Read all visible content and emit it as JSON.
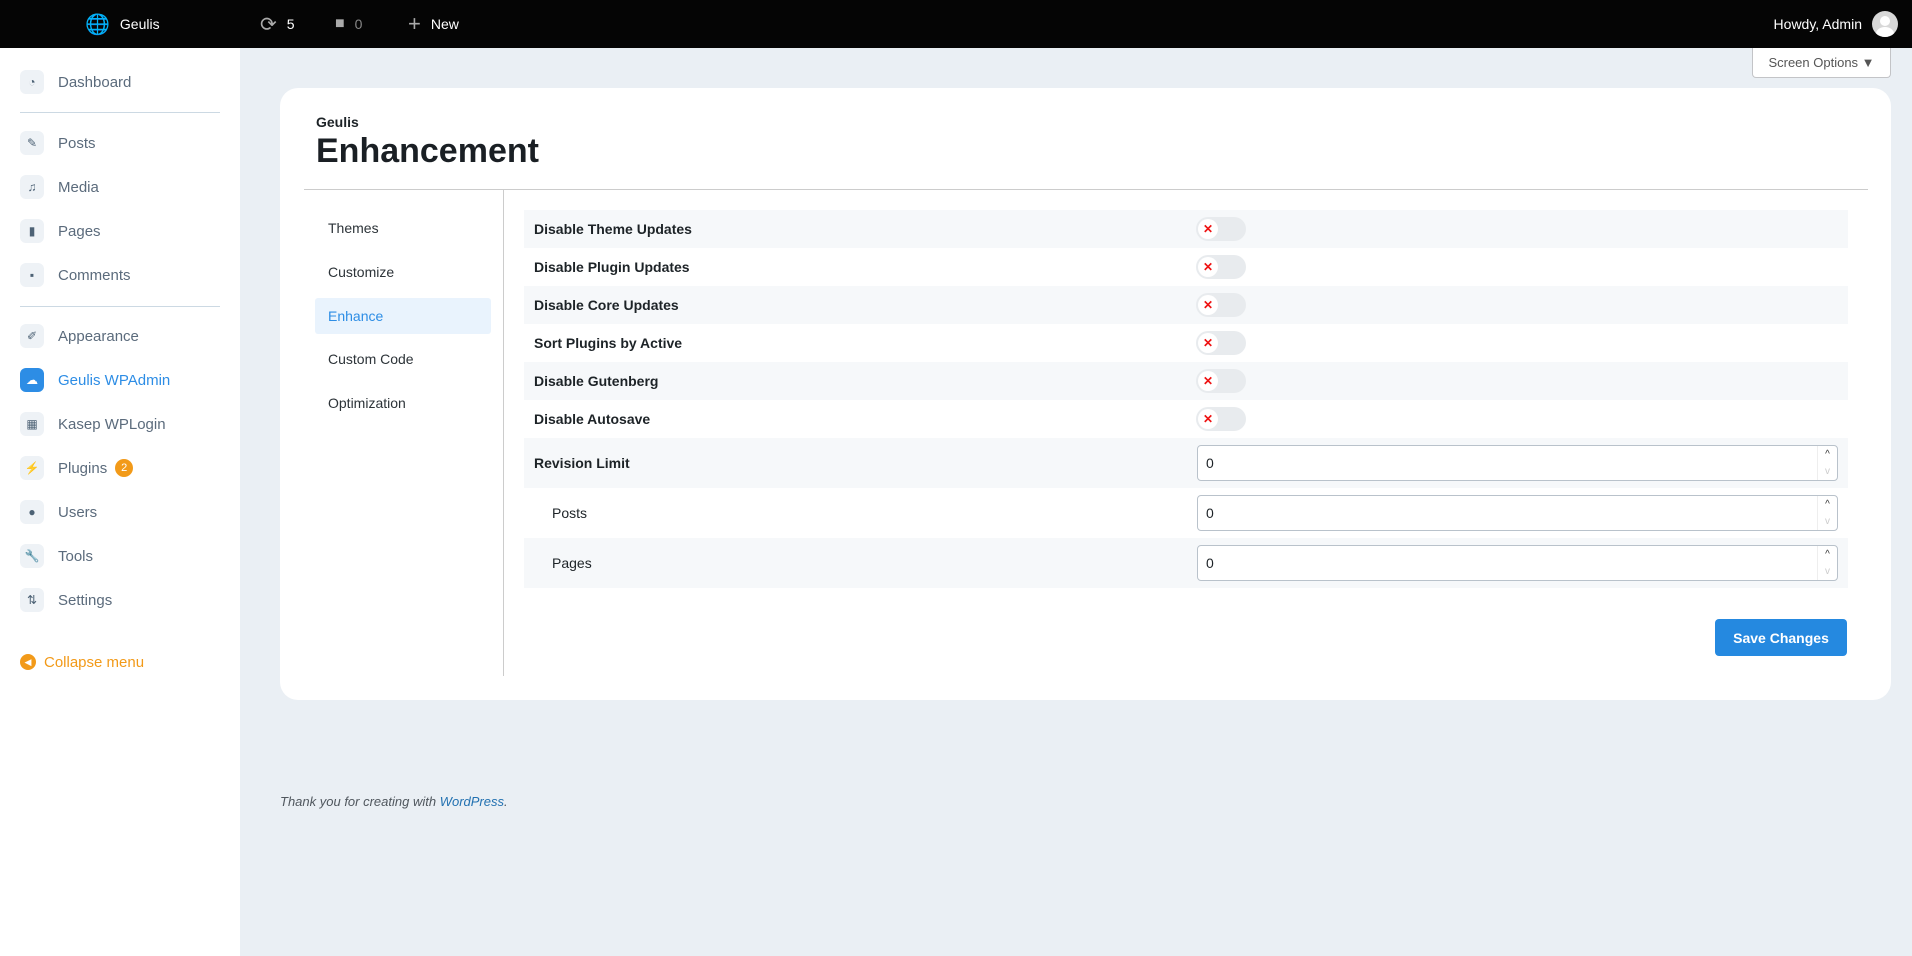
{
  "topbar": {
    "site": "Geulis",
    "updates": "5",
    "comments": "0",
    "new": "New",
    "howdy": "Howdy, Admin"
  },
  "screen_options": "Screen Options ▼",
  "sidebar": {
    "items": [
      {
        "label": "Dashboard",
        "icon": "dashboard-icon"
      },
      {
        "label": "Posts",
        "icon": "pin-icon"
      },
      {
        "label": "Media",
        "icon": "media-icon"
      },
      {
        "label": "Pages",
        "icon": "pages-icon"
      },
      {
        "label": "Comments",
        "icon": "comment-icon"
      },
      {
        "label": "Appearance",
        "icon": "brush-icon"
      },
      {
        "label": "Geulis WPAdmin",
        "icon": "cloud-icon"
      },
      {
        "label": "Kasep WPLogin",
        "icon": "grid-icon"
      },
      {
        "label": "Plugins",
        "icon": "plugin-icon",
        "badge": "2"
      },
      {
        "label": "Users",
        "icon": "user-icon"
      },
      {
        "label": "Tools",
        "icon": "wrench-icon"
      },
      {
        "label": "Settings",
        "icon": "settings-icon"
      }
    ],
    "collapse": "Collapse menu"
  },
  "page": {
    "crumb": "Geulis",
    "title": "Enhancement"
  },
  "tabs": [
    "Themes",
    "Customize",
    "Enhance",
    "Custom Code",
    "Optimization"
  ],
  "toggles": [
    "Disable Theme Updates",
    "Disable Plugin Updates",
    "Disable Core Updates",
    "Sort Plugins by Active",
    "Disable Gutenberg",
    "Disable Autosave"
  ],
  "numbers": [
    {
      "label": "Revision Limit",
      "value": "0"
    },
    {
      "label": "Posts",
      "value": "0"
    },
    {
      "label": "Pages",
      "value": "0"
    }
  ],
  "save": "Save Changes",
  "footer": {
    "text": "Thank you for creating with ",
    "link": "WordPress",
    "end": "."
  }
}
